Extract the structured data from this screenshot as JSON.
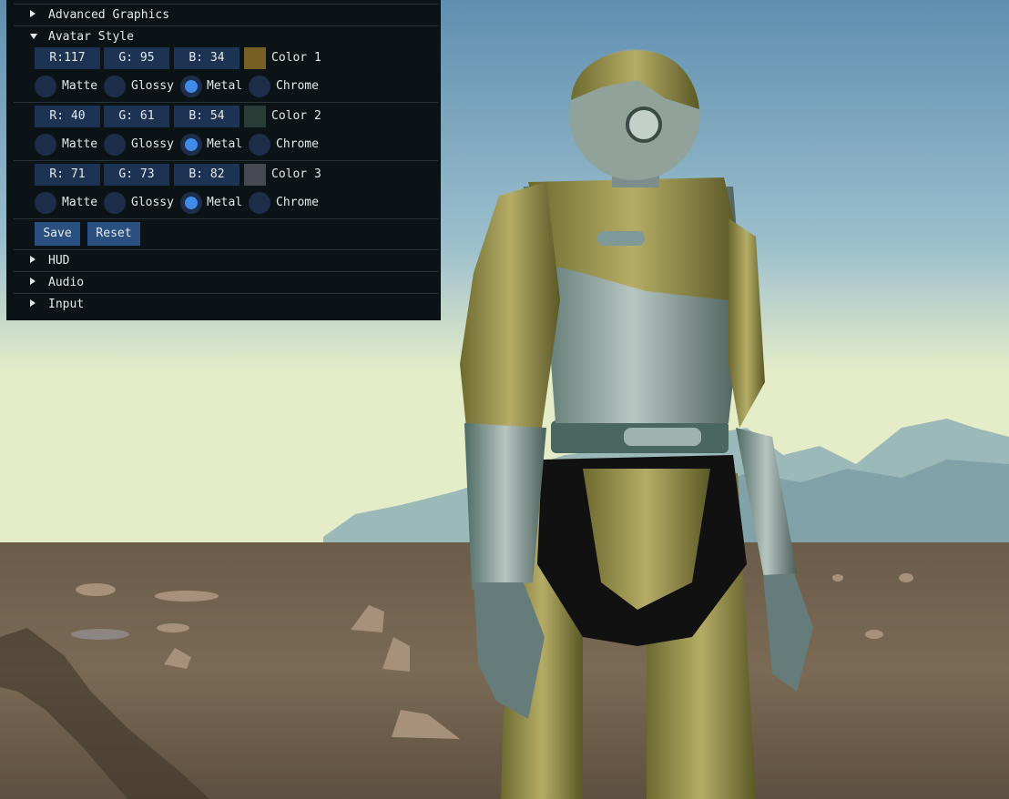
{
  "panel": {
    "sections": {
      "advanced_graphics": "Advanced Graphics",
      "avatar_style": "Avatar Style",
      "hud": "HUD",
      "audio": "Audio",
      "input": "Input"
    },
    "colors": [
      {
        "r": "R:117",
        "g": "G: 95",
        "b": "B: 34",
        "label": "Color 1",
        "swatch": "#755f22",
        "selected_material": "Metal"
      },
      {
        "r": "R: 40",
        "g": "G: 61",
        "b": "B: 54",
        "label": "Color 2",
        "swatch": "#283d36",
        "selected_material": "Metal"
      },
      {
        "r": "R: 71",
        "g": "G: 73",
        "b": "B: 82",
        "label": "Color 3",
        "swatch": "#474952",
        "selected_material": "Metal"
      }
    ],
    "materials": [
      "Matte",
      "Glossy",
      "Metal",
      "Chrome"
    ],
    "buttons": {
      "save": "Save",
      "reset": "Reset"
    }
  }
}
